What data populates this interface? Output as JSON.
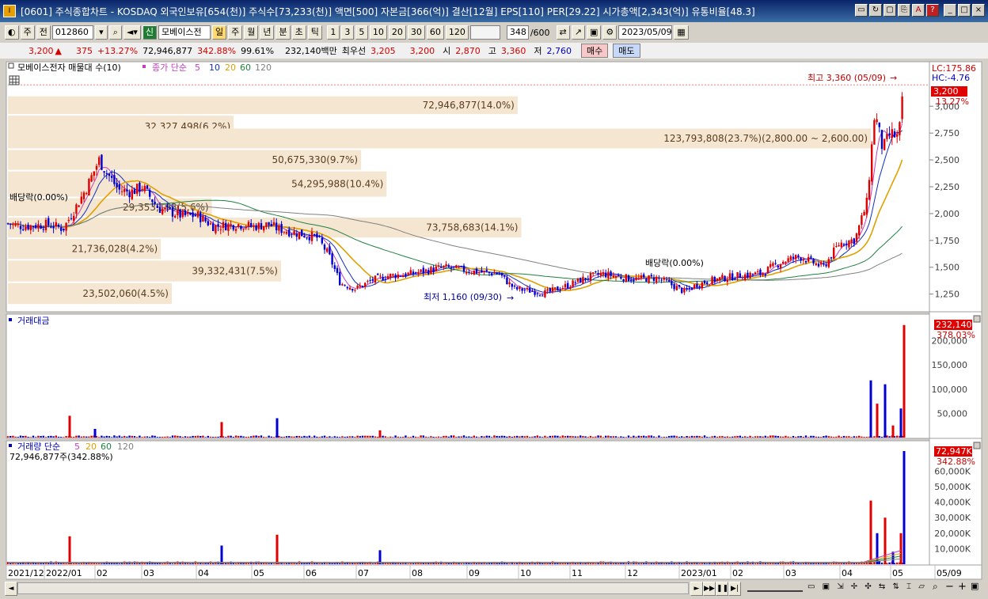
{
  "window": {
    "title": "[0601] 주식종합차트 - KOSDAQ 외국인보유[654(천)] 주식수[73,233(천)] 액면[500] 자본금[366(억)] 결산[12월] EPS[110] PER[29.22] 시가총액[2,343(억)] 유통비율[48.3]",
    "icon": "chart-app-icon",
    "buttons": [
      "▭",
      "↻",
      "▢",
      "⎘",
      "A",
      "?",
      "_",
      "□",
      "×"
    ]
  },
  "toolbar": {
    "code_prefix_1": "주",
    "code_prefix_2": "전",
    "code": "012860",
    "stock_badge": "신",
    "stock_name": "모베이스전",
    "periods": [
      "일",
      "주",
      "월",
      "년",
      "분",
      "초",
      "틱"
    ],
    "selected_period": "일",
    "intervals": [
      "1",
      "3",
      "5",
      "10",
      "20",
      "30",
      "60",
      "120"
    ],
    "count": "348",
    "count_total": "/600",
    "date": "2023/05/09"
  },
  "quote": {
    "price": "3,200",
    "change": "375",
    "change_pct": "+13.27%",
    "volume": "72,946,877",
    "volume_pct": "342.88%",
    "rate": "99.61%",
    "amount": "232,140백만",
    "best_label": "최우선",
    "best_ask": "3,205",
    "best_bid": "3,200",
    "open_label": "시",
    "open": "2,870",
    "high_label": "고",
    "high": "3,360",
    "low_label": "저",
    "low": "2,760",
    "buy_label": "매수",
    "sell_label": "매도"
  },
  "legend": {
    "profile_label": "모베이스전자 매물대 수(10)",
    "ma_label": "종가 단순",
    "ma_periods": [
      "5",
      "10",
      "20",
      "60",
      "120"
    ],
    "ma_colors": [
      "#c040c0",
      "#1030c0",
      "#e0a000",
      "#208040",
      "#808080"
    ],
    "lc": "LC:175.86",
    "hc": "HC:-4.76",
    "price_tag": "3,200",
    "price_tag_pct": "13.27%"
  },
  "annotations": {
    "high": "최고 3,360 (05/09)",
    "low": "최저 1,160 (09/30)",
    "div1": "배당락(0.00%)",
    "div2": "배당락(0.00%)"
  },
  "volume_panel": {
    "title": "거래대금",
    "tag": "232,140",
    "tag_pct": "378.03%",
    "ticks": [
      "200,000",
      "150,000",
      "100,000",
      "50,000"
    ]
  },
  "qty_panel": {
    "title": "거래량 단순",
    "ma_periods": [
      "5",
      "20",
      "60",
      "120"
    ],
    "value_label": "72,946,877주(342.88%)",
    "tag": "72,947K",
    "tag_pct": "342.88%",
    "ticks": [
      "60,000K",
      "50,000K",
      "40,000K",
      "30,000K",
      "20,000K",
      "10,000K"
    ]
  },
  "xaxis_labels": [
    "2021/12",
    "2022/01",
    "02",
    "03",
    "04",
    "05",
    "06",
    "07",
    "08",
    "09",
    "10",
    "11",
    "12",
    "2023/01",
    "02",
    "03",
    "04",
    "05",
    "05/09"
  ],
  "chart_data": {
    "type": "candlestick",
    "y_range": [
      1100,
      3400
    ],
    "yticks": [
      1250,
      1500,
      1750,
      2000,
      2250,
      2500,
      2750,
      3000
    ],
    "price_path": [
      [
        0,
        1920
      ],
      [
        30,
        1880
      ],
      [
        60,
        1900
      ],
      [
        80,
        1860
      ],
      [
        95,
        2050
      ],
      [
        110,
        2250
      ],
      [
        125,
        2500
      ],
      [
        135,
        2380
      ],
      [
        150,
        2220
      ],
      [
        165,
        2200
      ],
      [
        180,
        2250
      ],
      [
        190,
        2150
      ],
      [
        200,
        2050
      ],
      [
        230,
        1980
      ],
      [
        250,
        1980
      ],
      [
        270,
        1880
      ],
      [
        300,
        1900
      ],
      [
        320,
        1880
      ],
      [
        340,
        1900
      ],
      [
        350,
        1860
      ],
      [
        380,
        1810
      ],
      [
        400,
        1780
      ],
      [
        415,
        1620
      ],
      [
        430,
        1350
      ],
      [
        450,
        1300
      ],
      [
        470,
        1380
      ],
      [
        490,
        1420
      ],
      [
        520,
        1440
      ],
      [
        560,
        1500
      ],
      [
        600,
        1460
      ],
      [
        630,
        1440
      ],
      [
        650,
        1300
      ],
      [
        670,
        1280
      ],
      [
        690,
        1260
      ],
      [
        720,
        1340
      ],
      [
        740,
        1400
      ],
      [
        760,
        1440
      ],
      [
        800,
        1390
      ],
      [
        830,
        1400
      ],
      [
        850,
        1330
      ],
      [
        865,
        1270
      ],
      [
        880,
        1340
      ],
      [
        900,
        1380
      ],
      [
        930,
        1420
      ],
      [
        960,
        1440
      ],
      [
        990,
        1560
      ],
      [
        1010,
        1600
      ],
      [
        1040,
        1500
      ],
      [
        1060,
        1720
      ],
      [
        1080,
        1760
      ],
      [
        1095,
        2100
      ],
      [
        1105,
        2950
      ],
      [
        1115,
        2600
      ],
      [
        1125,
        2750
      ],
      [
        1135,
        2700
      ],
      [
        1142,
        3200
      ]
    ],
    "volume_profile": [
      {
        "label": "72,946,877(14.0%)",
        "volume": 72946877,
        "pct": 14.0,
        "price_low": 2920,
        "price_high": 3100
      },
      {
        "label": "32,327,498(6.2%)",
        "volume": 32327498,
        "pct": 6.2,
        "price_low": 2700,
        "price_high": 2920
      },
      {
        "label": "123,793,808(23.7%)(2,800.00 ~ 2,600.00)",
        "volume": 123793808,
        "pct": 23.7,
        "price_low": 2600,
        "price_high": 2800
      },
      {
        "label": "50,675,330(9.7%)",
        "volume": 50675330,
        "pct": 9.7,
        "price_low": 2400,
        "price_high": 2600
      },
      {
        "label": "54,295,988(10.4%)",
        "volume": 54295988,
        "pct": 10.4,
        "price_low": 2150,
        "price_high": 2400
      },
      {
        "label": "29,353,193(5.6%)",
        "volume": 29353193,
        "pct": 5.6,
        "price_low": 1970,
        "price_high": 2150
      },
      {
        "label": "73,758,683(14.1%)",
        "volume": 73758683,
        "pct": 14.1,
        "price_low": 1770,
        "price_high": 1970
      },
      {
        "label": "21,736,028(4.2%)",
        "volume": 21736028,
        "pct": 4.2,
        "price_low": 1570,
        "price_high": 1770
      },
      {
        "label": "39,332,431(7.5%)",
        "volume": 39332431,
        "pct": 7.5,
        "price_low": 1360,
        "price_high": 1570
      },
      {
        "label": "23,502,060(4.5%)",
        "volume": 23502060,
        "pct": 4.5,
        "price_low": 1150,
        "price_high": 1360
      }
    ],
    "amount_spikes": [
      [
        88,
        45000
      ],
      [
        120,
        18000
      ],
      [
        280,
        32000
      ],
      [
        350,
        40000
      ],
      [
        480,
        15000
      ],
      [
        1100,
        118000
      ],
      [
        1108,
        70000
      ],
      [
        1118,
        110000
      ],
      [
        1128,
        25000
      ],
      [
        1138,
        60000
      ],
      [
        1142,
        232140
      ]
    ],
    "qty_spikes": [
      [
        88,
        18000
      ],
      [
        280,
        12000
      ],
      [
        350,
        19000
      ],
      [
        480,
        9000
      ],
      [
        1100,
        41000
      ],
      [
        1108,
        20000
      ],
      [
        1118,
        30000
      ],
      [
        1128,
        8000
      ],
      [
        1138,
        20000
      ],
      [
        1142,
        72947
      ]
    ]
  }
}
